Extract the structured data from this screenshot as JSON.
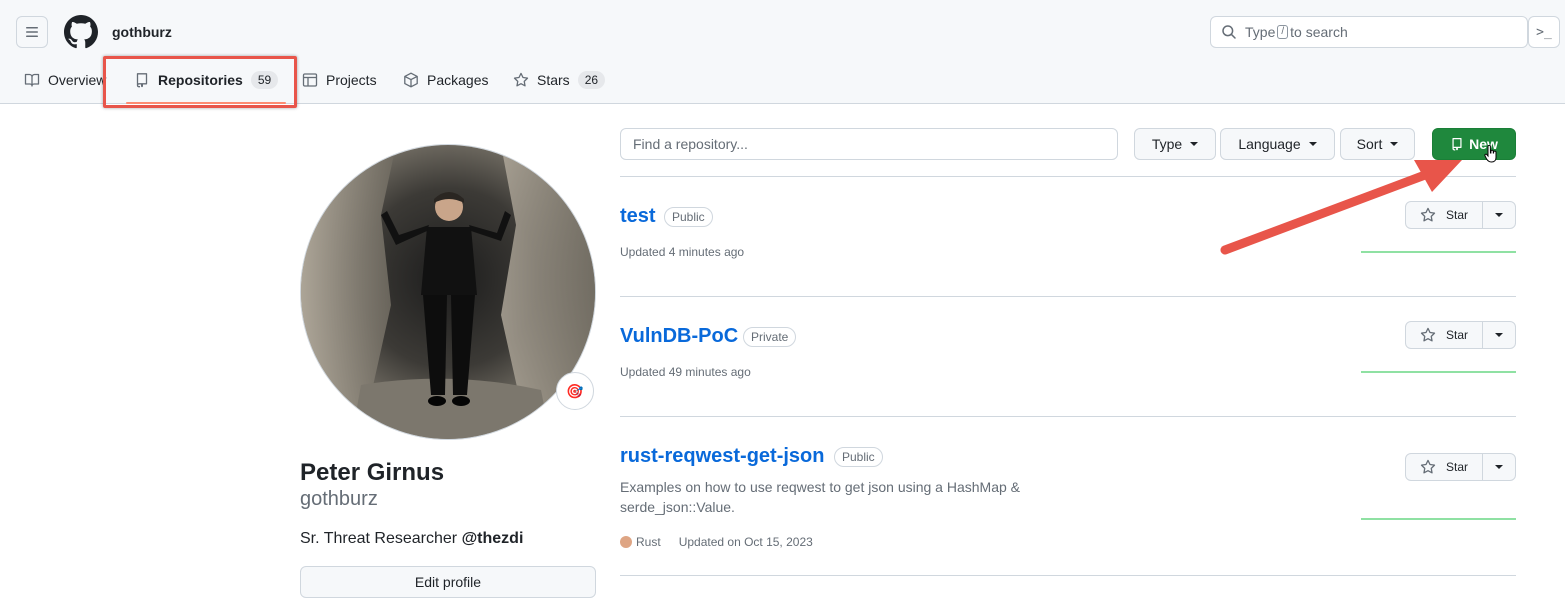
{
  "header": {
    "owner": "gothburz",
    "search_prefix": "Type",
    "search_key": "/",
    "search_suffix": "to search",
    "command_symbol": "⌘",
    "command_prompt": ">_"
  },
  "tabs": [
    {
      "label": "Overview",
      "icon": "book-icon"
    },
    {
      "label": "Repositories",
      "count": "59",
      "icon": "repo-icon",
      "selected": true
    },
    {
      "label": "Projects",
      "icon": "table-icon"
    },
    {
      "label": "Packages",
      "icon": "package-icon"
    },
    {
      "label": "Stars",
      "count": "26",
      "icon": "star-icon"
    }
  ],
  "profile": {
    "full_name": "Peter Girnus",
    "login": "gothburz",
    "bio_text": "Sr. Threat Researcher ",
    "bio_handle": "@thezdi",
    "status_emoji": "🎯",
    "edit_label": "Edit profile"
  },
  "filters": {
    "find_placeholder": "Find a repository...",
    "type_label": "Type",
    "language_label": "Language",
    "sort_label": "Sort",
    "new_label": "New"
  },
  "repos": [
    {
      "name": "test",
      "visibility": "Public",
      "description": "",
      "language": "",
      "updated": "Updated 4 minutes ago",
      "star_label": "Star"
    },
    {
      "name": "VulnDB-PoC",
      "visibility": "Private",
      "description": "",
      "language": "",
      "updated": "Updated 49 minutes ago",
      "star_label": "Star"
    },
    {
      "name": "rust-reqwest-get-json",
      "visibility": "Public",
      "description_line1": "Examples on how to use reqwest to get json using a HashMap &",
      "description_line2": "serde_json::Value.",
      "language": "Rust",
      "language_color": "#dea584",
      "updated": "Updated on Oct 15, 2023",
      "star_label": "Star"
    }
  ],
  "colors": {
    "accent_green": "#1f883d",
    "link_blue": "#0969da",
    "annotation_red": "#e8554a"
  }
}
